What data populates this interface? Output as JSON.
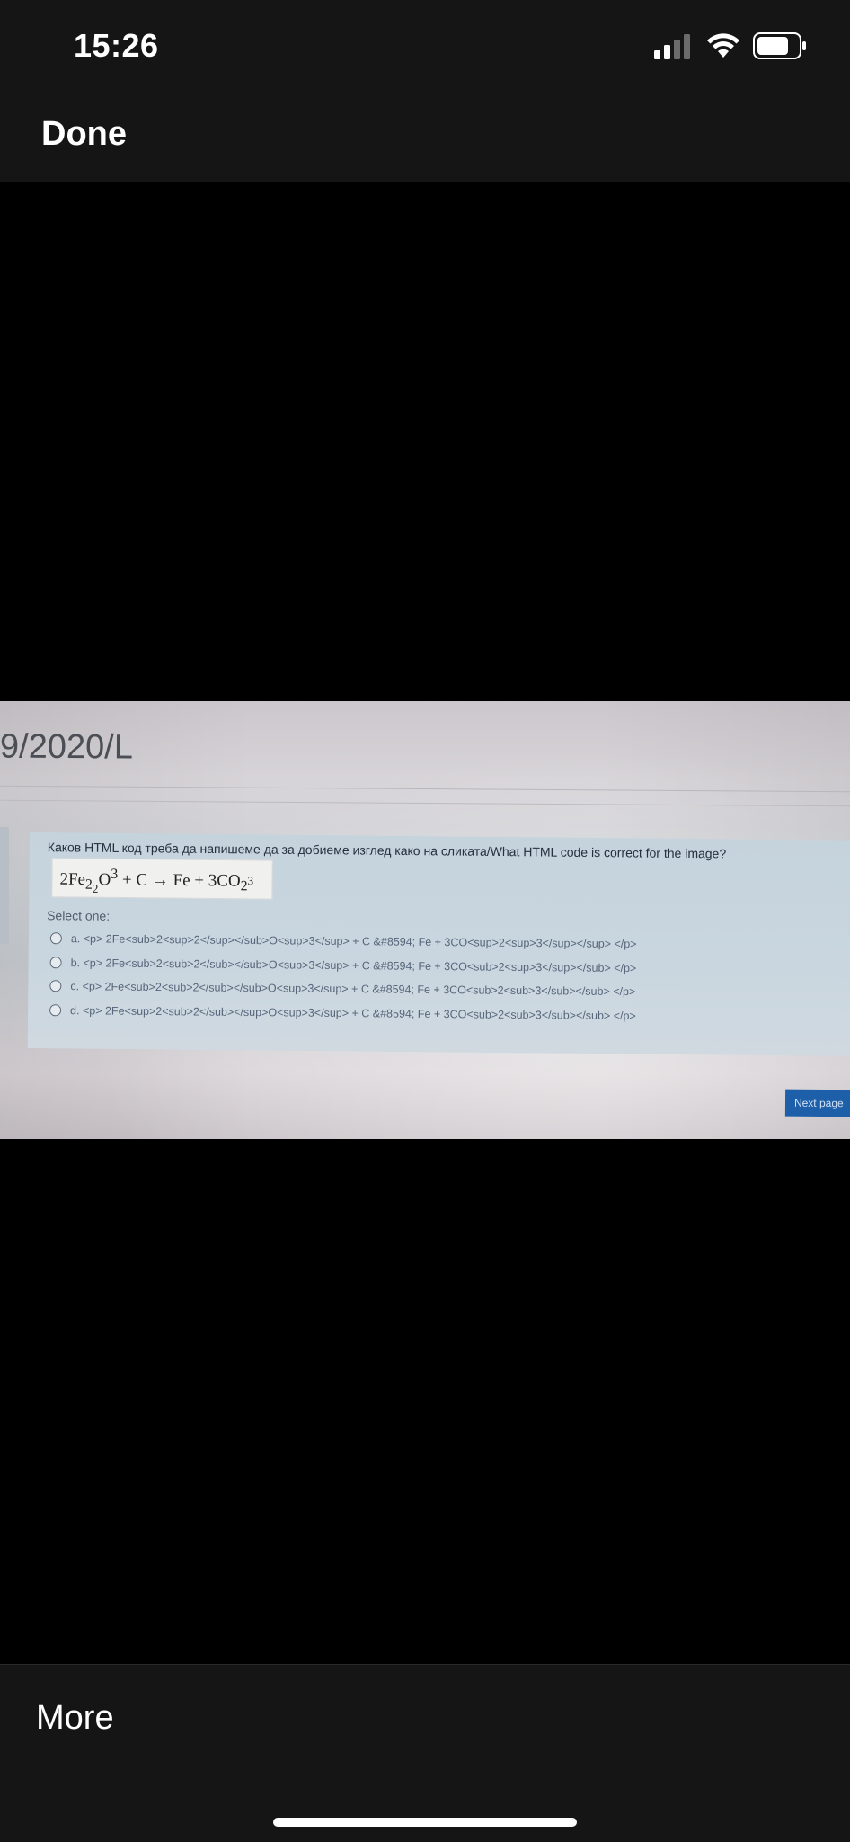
{
  "status_bar": {
    "time": "15:26"
  },
  "nav": {
    "done_label": "Done"
  },
  "photo": {
    "breadcrumb": "9/2020/L",
    "question": "Каков HTML код треба да напишеме да за добиеме изглед како на сликата/What HTML code is correct for the image?",
    "formula": {
      "part1": "2Fe",
      "sub1": "2",
      "sub2": "2",
      "part2": "O",
      "sup1": "3",
      "part3": " + C → Fe + 3CO",
      "sub3": "2",
      "sup2": "3"
    },
    "select_label": "Select one:",
    "options": [
      "a. <p> 2Fe<sub>2<sup>2</sup></sub>O<sup>3</sup> + C &#8594; Fe + 3CO<sup>2<sup>3</sup></sup> </p>",
      "b. <p> 2Fe<sub>2<sub>2</sub></sub>O<sup>3</sup> + C &#8594; Fe + 3CO<sub>2<sup>3</sup></sub> </p>",
      "c. <p> 2Fe<sub>2<sub>2</sub></sub>O<sup>3</sup> + C &#8594; Fe + 3CO<sub>2<sub>3</sub></sub> </p>",
      "d. <p> 2Fe<sup>2<sub>2</sub></sup>O<sup>3</sup> + C &#8594; Fe + 3CO<sub>2<sub>3</sub></sub> </p>"
    ],
    "next_label": "Next page"
  },
  "bottom": {
    "more_label": "More"
  },
  "icons": {
    "signal": "cellular-signal-icon",
    "wifi": "wifi-icon",
    "battery": "battery-icon"
  }
}
